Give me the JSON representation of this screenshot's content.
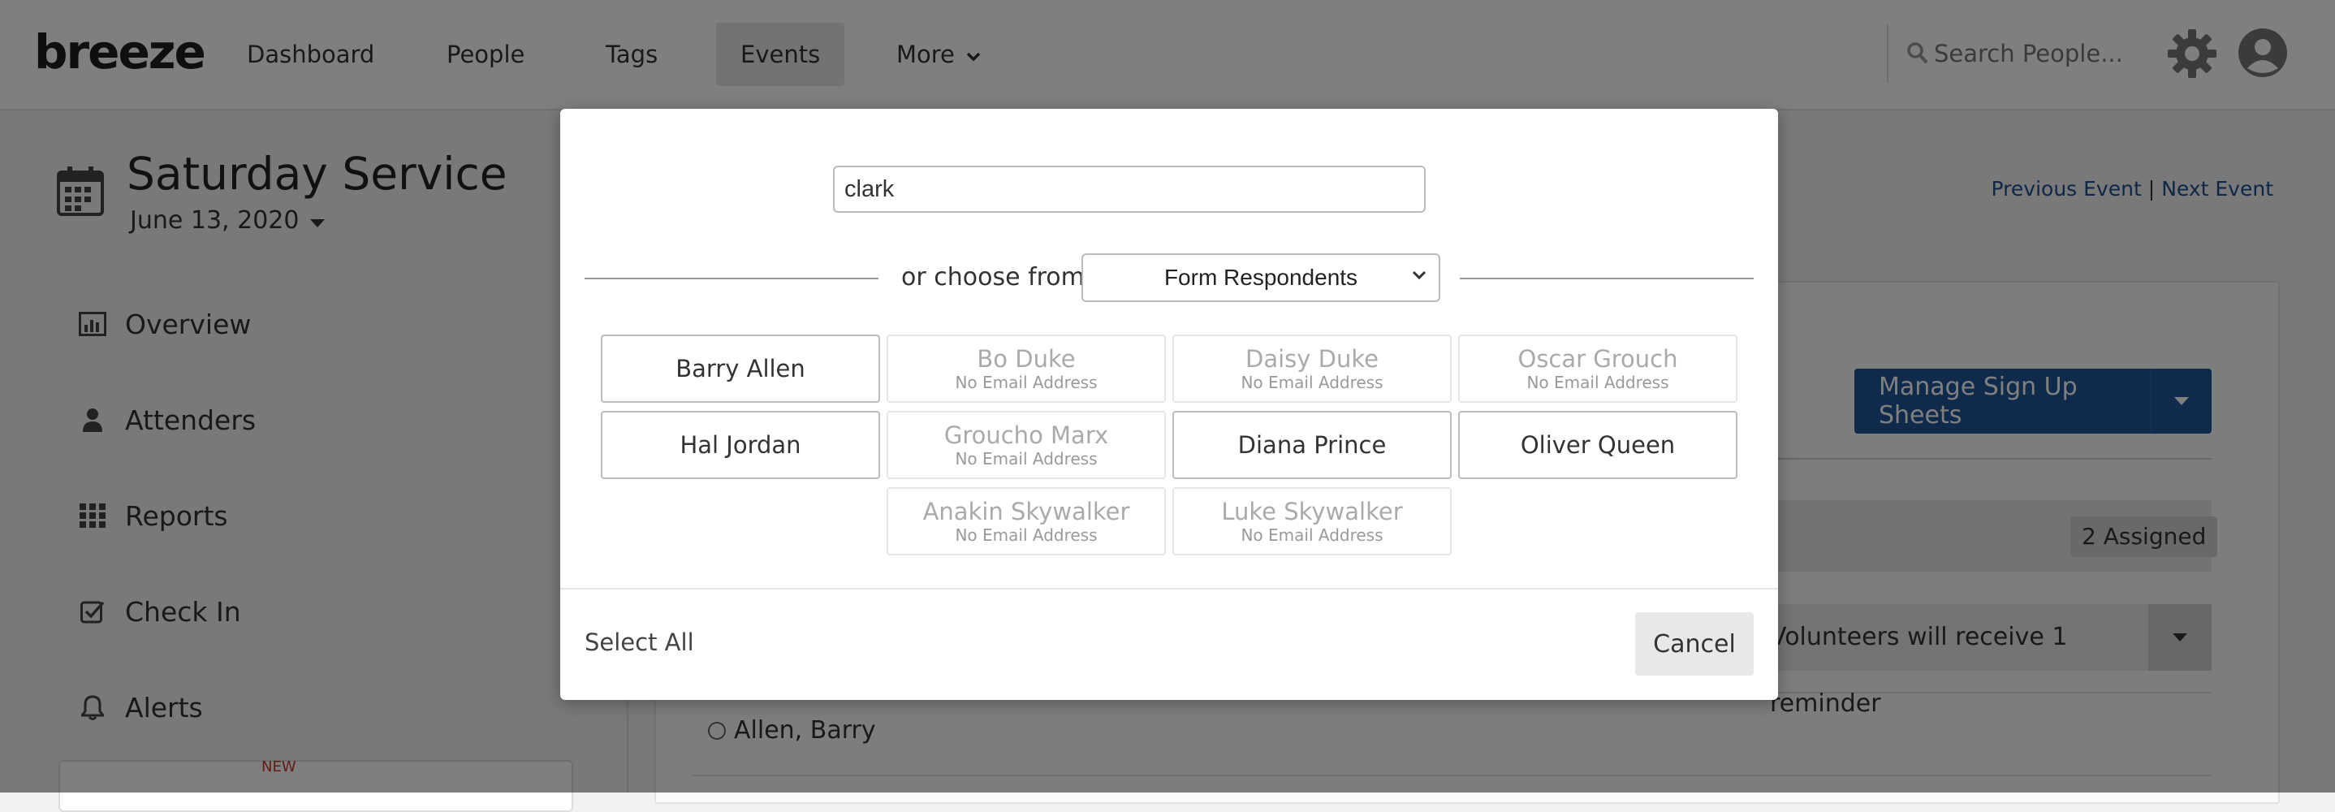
{
  "nav": {
    "logo": "breeze",
    "items": [
      {
        "label": "Dashboard"
      },
      {
        "label": "People"
      },
      {
        "label": "Tags"
      },
      {
        "label": "Events"
      },
      {
        "label": "More"
      }
    ],
    "active_item": "Events",
    "search_placeholder": "Search People..."
  },
  "event": {
    "title": "Saturday Service",
    "date": "June 13, 2020",
    "prev_label": "Previous Event",
    "next_label": "Next Event",
    "separator": "|"
  },
  "sidebar": {
    "items": [
      {
        "label": "Overview",
        "icon": "bar-chart-icon"
      },
      {
        "label": "Attenders",
        "icon": "person-icon"
      },
      {
        "label": "Reports",
        "icon": "grid-icon"
      },
      {
        "label": "Check In",
        "icon": "checkbox-icon"
      },
      {
        "label": "Alerts",
        "icon": "bell-icon"
      }
    ],
    "card_badge": "NEW"
  },
  "main": {
    "manage_button_label": "Manage Sign Up Sheets",
    "assigned_label": "2 Assigned",
    "reminder_text": "Volunteers will receive 1 reminder",
    "first_row": "Allen, Barry"
  },
  "modal": {
    "search_value": "clark",
    "choose_label": "or choose from",
    "choose_selected": "Form Respondents",
    "people": [
      {
        "name": "Barry Allen",
        "email": "",
        "enabled": true
      },
      {
        "name": "Bo Duke",
        "email": "No Email Address",
        "enabled": false
      },
      {
        "name": "Daisy Duke",
        "email": "No Email Address",
        "enabled": false
      },
      {
        "name": "Oscar Grouch",
        "email": "No Email Address",
        "enabled": false
      },
      {
        "name": "Hal Jordan",
        "email": "",
        "enabled": true
      },
      {
        "name": "Groucho Marx",
        "email": "No Email Address",
        "enabled": false
      },
      {
        "name": "Diana Prince",
        "email": "",
        "enabled": true
      },
      {
        "name": "Oliver Queen",
        "email": "",
        "enabled": true
      },
      {
        "name": "Anakin Skywalker",
        "email": "No Email Address",
        "enabled": false
      },
      {
        "name": "Luke Skywalker",
        "email": "No Email Address",
        "enabled": false
      }
    ],
    "select_all_label": "Select All",
    "cancel_label": "Cancel"
  },
  "colors": {
    "primary": "#1f5596",
    "link": "#1d4f91",
    "overlay": "rgba(0,0,0,0.5)"
  }
}
